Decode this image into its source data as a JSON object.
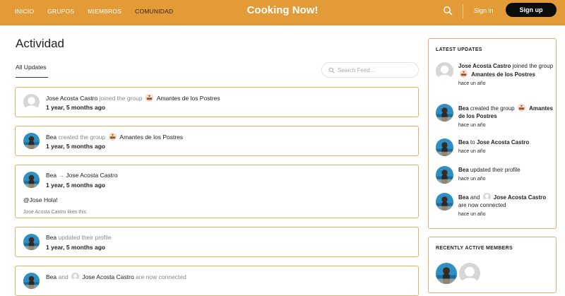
{
  "nav": {
    "items": [
      {
        "label": "INICIO"
      },
      {
        "label": "GRUPOS"
      },
      {
        "label": "MIEMBROS"
      },
      {
        "label": "COMUNIDAD"
      }
    ],
    "brand": "Cooking Now!",
    "signin": "Sign in",
    "signup": "Sign up"
  },
  "colors": {
    "accent": "#E29B36",
    "border": "#E2B06A",
    "button": "#0c0c0c"
  },
  "page": {
    "title": "Actividad",
    "tab": "All Updates",
    "search_placeholder": "Search Feed..."
  },
  "feed": [
    {
      "actor": "Jose Acosta Castro",
      "verb": "joined the group",
      "group": "Amantes de los Postres",
      "time": "1 year, 5 months ago"
    },
    {
      "actor": "Bea",
      "verb": "created the group",
      "group": "Amantes de los Postres",
      "time": "1 year, 5 months ago"
    },
    {
      "actor": "Bea",
      "arrow": "→",
      "target": "Jose Acosta Castro",
      "time": "1 year, 5 months ago",
      "message": "@Jose Hola!",
      "likes": "Jose Acosta Castro likes this"
    },
    {
      "actor": "Bea",
      "verb": "updated their profile",
      "time": "1 year, 5 months ago"
    },
    {
      "actor": "Bea",
      "conj": "and",
      "target": "Jose Acosta Castro",
      "verb": "are now connected"
    }
  ],
  "sidebar": {
    "latest_title": "LATEST UPDATES",
    "updates": [
      {
        "actor": "Jose Acosta Castro",
        "verb": "joined the group",
        "group": "Amantes de los Postres",
        "time": "hace un año"
      },
      {
        "actor": "Bea",
        "verb": "created the group",
        "group": "Amantes de los Postres",
        "time": "hace un año"
      },
      {
        "actor": "Bea",
        "conj": "to",
        "target": "Jose Acosta Castro",
        "time": "hace un año"
      },
      {
        "actor": "Bea",
        "verb": "updated their profile",
        "time": "hace un año"
      },
      {
        "actor": "Bea",
        "conj": "and",
        "target": "Jose Acosta Castro",
        "verb": "are now connected",
        "time": "hace un año"
      }
    ],
    "members_title": "RECENTLY ACTIVE MEMBERS"
  }
}
